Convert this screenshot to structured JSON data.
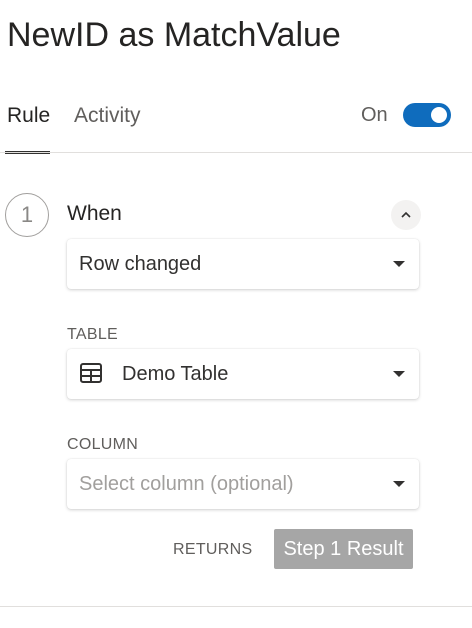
{
  "header": {
    "title": "NewID as MatchValue"
  },
  "tabs": [
    {
      "label": "Rule",
      "active": true
    },
    {
      "label": "Activity",
      "active": false
    }
  ],
  "toggle": {
    "label": "On",
    "enabled": true,
    "color": "#0f6cbd"
  },
  "step": {
    "number": "1",
    "title": "When",
    "collapse_icon": "chevron-up-icon",
    "event": {
      "value": "Row changed"
    },
    "table": {
      "label": "TABLE",
      "icon": "table-icon",
      "value": "Demo Table"
    },
    "column": {
      "label": "COLUMN",
      "placeholder": "Select column (optional)"
    },
    "returns": {
      "label": "RETURNS",
      "value": "Step 1 Result"
    }
  }
}
